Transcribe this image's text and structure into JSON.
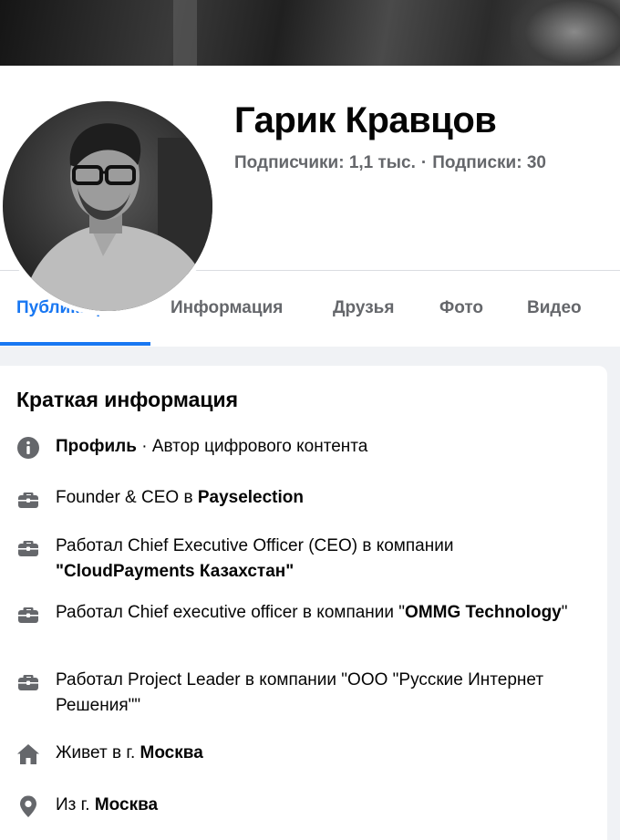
{
  "profile": {
    "name": "Гарик Кравцов",
    "followers_label": "Подписчики:",
    "followers_value": "1,1 тыс.",
    "separator": "·",
    "following_label": "Подписки:",
    "following_value": "30"
  },
  "tabs": [
    {
      "label": "Публикации",
      "active": true
    },
    {
      "label": "Информация",
      "active": false
    },
    {
      "label": "Друзья",
      "active": false
    },
    {
      "label": "Фото",
      "active": false
    },
    {
      "label": "Видео",
      "active": false
    }
  ],
  "intro": {
    "title": "Краткая информация",
    "items": [
      {
        "icon": "info-icon",
        "bold1": "Профиль",
        "text1": " · Автор цифрового контента",
        "bold2": "",
        "text2": ""
      },
      {
        "icon": "briefcase-icon",
        "bold1": "",
        "text1": "Founder & CEO в ",
        "bold2": "Payselection",
        "text2": ""
      },
      {
        "icon": "briefcase-icon",
        "bold1": "",
        "text1": "Работал Chief Executive Officer (CEO) в компании ",
        "bold2": "\"CloudPayments Казахстан\"",
        "text2": ""
      },
      {
        "icon": "briefcase-icon",
        "bold1": "",
        "text1": "Работал Chief executive officer в компании \"",
        "bold2": "OMMG Technology",
        "text2": "\""
      },
      {
        "icon": "briefcase-icon",
        "bold1": "",
        "text1": "Работал Project Leader в компании \"ООО \"Русские Интернет Решения\"\"",
        "bold2": "",
        "text2": ""
      },
      {
        "icon": "home-icon",
        "bold1": "",
        "text1": "Живет в г. ",
        "bold2": "Москва",
        "text2": ""
      },
      {
        "icon": "location-pin-icon",
        "bold1": "",
        "text1": "Из г. ",
        "bold2": "Москва",
        "text2": ""
      }
    ]
  },
  "colors": {
    "accent": "#1877f2",
    "secondary_text": "#65676b",
    "icon": "#65676b",
    "page_background": "#f0f2f5"
  }
}
